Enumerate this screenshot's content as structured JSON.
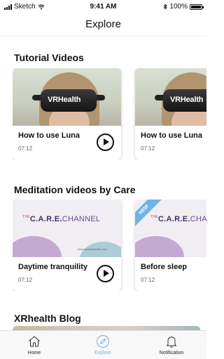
{
  "status_bar": {
    "carrier": "Sketch",
    "time": "9:41 AM",
    "battery": "100%",
    "battery_level": 1.0
  },
  "nav": {
    "title": "Explore"
  },
  "sections": {
    "tutorial": {
      "title": "Tutorial Videos",
      "cards": [
        {
          "title": "How to use Luna",
          "duration": "07:12",
          "image_text": "VRHealth"
        },
        {
          "title": "How to use Luna",
          "duration": "07:12",
          "image_text": "VRHealth"
        }
      ]
    },
    "meditation": {
      "title": "Meditation videos by Care",
      "cards": [
        {
          "title": "Daytime tranquility",
          "duration": "07:12",
          "image_the": "THE",
          "image_title": "C.A.R.E.",
          "image_channel": "CHANNEL",
          "image_url": "www.healinghealth.com"
        },
        {
          "title": "Before sleep",
          "duration": "07:12",
          "badge": "NEW",
          "image_the": "THE",
          "image_title": "C.A.R.E.",
          "image_channel": "CHA"
        }
      ]
    },
    "blog": {
      "title": "XRhealth Blog"
    }
  },
  "tab_bar": {
    "tabs": [
      {
        "label": "Home",
        "icon": "home-icon"
      },
      {
        "label": "Explore",
        "icon": "compass-icon",
        "active": true
      },
      {
        "label": "Notification",
        "icon": "bell-icon"
      }
    ],
    "active_color": "#6fb4e4"
  }
}
